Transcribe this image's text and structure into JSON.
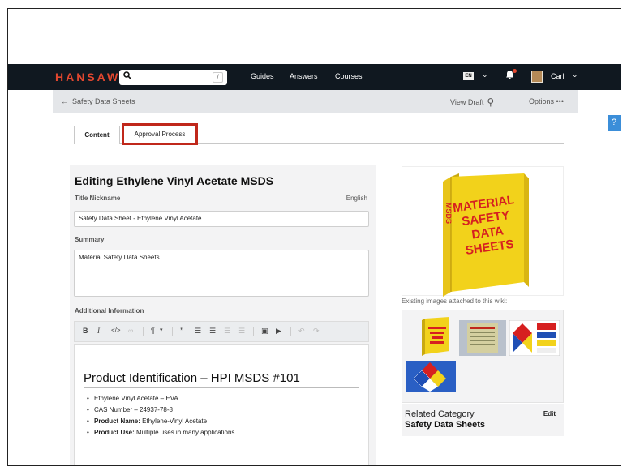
{
  "header": {
    "logo": "HANSAW",
    "search_slash": "/",
    "nav": [
      "Guides",
      "Answers",
      "Courses"
    ],
    "lang_badge": "EN",
    "user_name": "Carl"
  },
  "subbar": {
    "back_label": "Safety Data Sheets",
    "view_draft": "View Draft",
    "options": "Options •••"
  },
  "help_label": "?",
  "tabs": [
    {
      "label": "Content",
      "active": true
    },
    {
      "label": "Approval Process",
      "highlighted": true
    }
  ],
  "editor": {
    "title": "Editing Ethylene Vinyl Acetate MSDS",
    "title_nickname_label": "Title Nickname",
    "language": "English",
    "title_nickname_value": "Safety Data Sheet - Ethylene Vinyl Acetate",
    "summary_label": "Summary",
    "summary_value": "Material Safety Data Sheets",
    "additional_label": "Additional Information",
    "heading": "Product Identification – HPI MSDS #101",
    "bullets": [
      {
        "bold": "",
        "text": "Ethylene Vinyl Acetate – EVA"
      },
      {
        "bold": "",
        "text": "CAS Number – 24937-78-8"
      },
      {
        "bold": "Product Name:",
        "text": " Ethylene-Vinyl Acetate"
      },
      {
        "bold": "Product Use:",
        "text": " Multiple uses in many applications"
      }
    ]
  },
  "binder": {
    "lines": [
      "MATERIAL",
      "SAFETY",
      "DATA",
      "SHEETS"
    ],
    "spine": "MSDS",
    "color": "#f2d21b",
    "text_color": "#d62020"
  },
  "existing_label": "Existing images attached to this wiki:",
  "related": {
    "label": "Related Category",
    "value": "Safety Data Sheets",
    "edit": "Edit"
  },
  "colors": {
    "topbar": "#101820",
    "logo": "#e2472f",
    "highlight": "#c0281b",
    "help": "#3b8ed9"
  }
}
